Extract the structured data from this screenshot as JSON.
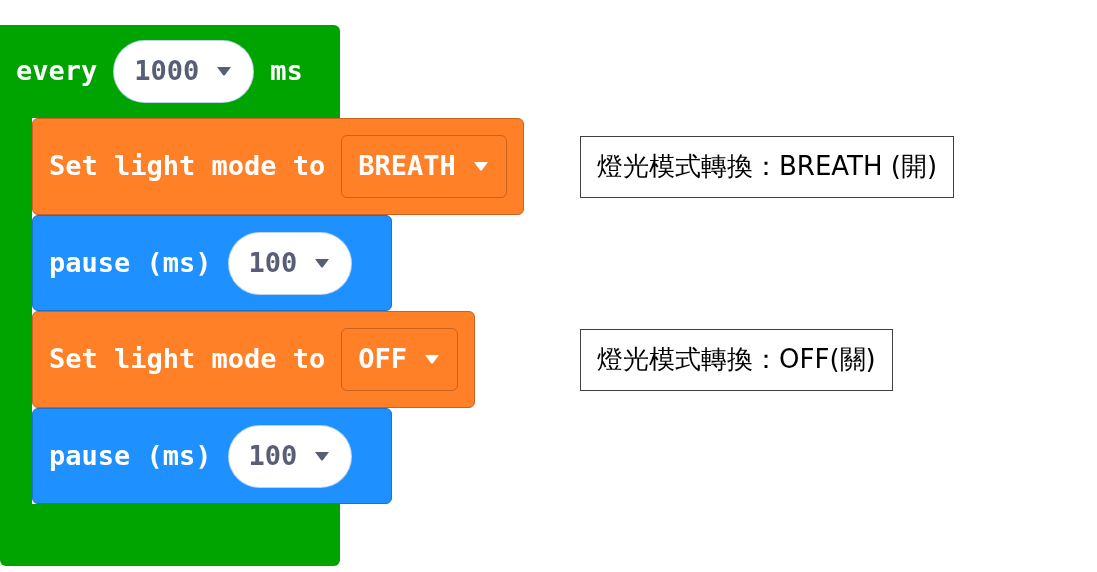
{
  "loop": {
    "label": "every",
    "value": "1000",
    "unit": "ms"
  },
  "blocks": [
    {
      "kind": "set_mode",
      "label": "Set light mode to",
      "value": "BREATH",
      "note": "燈光模式轉換：BREATH (開)"
    },
    {
      "kind": "pause",
      "label": "pause (ms)",
      "value": "100"
    },
    {
      "kind": "set_mode",
      "label": "Set light mode to",
      "value": "OFF",
      "note": "燈光模式轉換：OFF(關)"
    },
    {
      "kind": "pause",
      "label": "pause (ms)",
      "value": "100"
    }
  ]
}
